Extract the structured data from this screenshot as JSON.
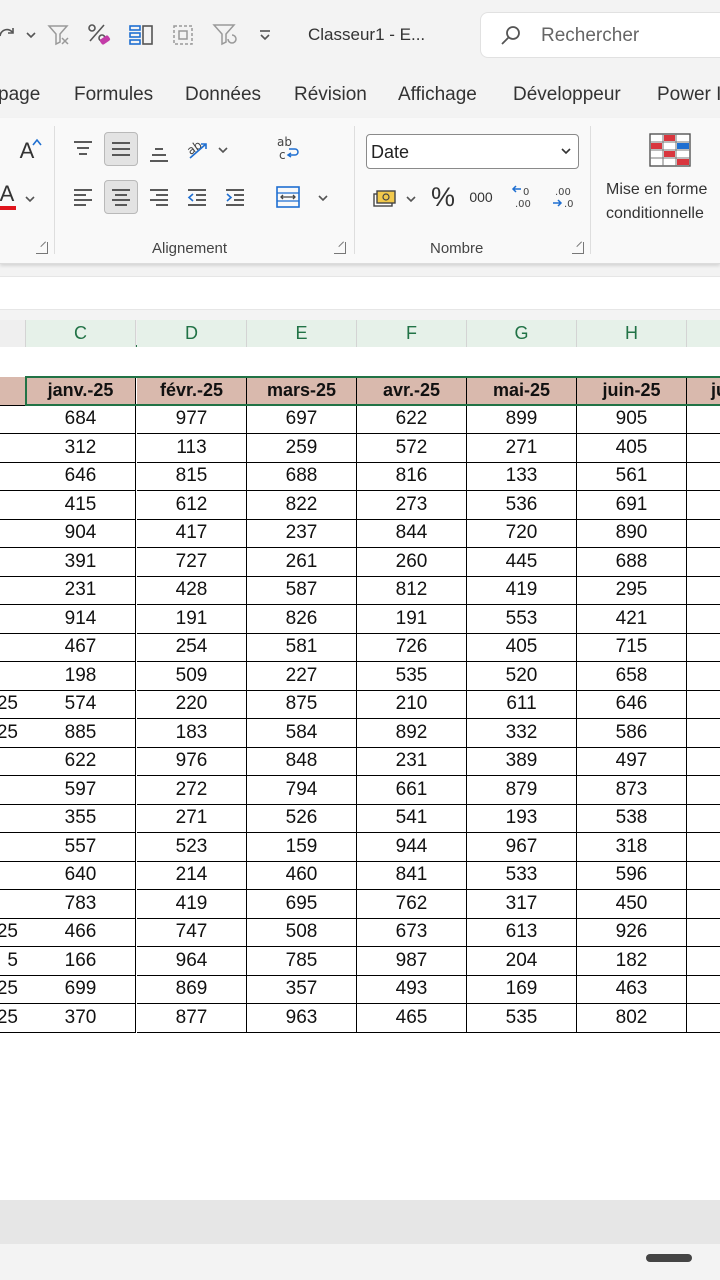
{
  "titlebar": {
    "doc_title": "Classeur1  -  E...",
    "search_placeholder": "Rechercher"
  },
  "ribbon_tabs": [
    "page",
    "Formules",
    "Données",
    "Révision",
    "Affichage",
    "Développeur",
    "Power I"
  ],
  "ribbon": {
    "alignment_label": "Alignement",
    "number_label": "Nombre",
    "number_format_value": "Date",
    "percent_symbol": "%",
    "thousands_symbol": "000",
    "cond_format_line1": "Mise en forme",
    "cond_format_line2": "conditionnelle",
    "font_letter_a": "A",
    "wrap_text_glyph": "ab"
  },
  "sheet": {
    "columns": [
      "C",
      "D",
      "E",
      "F",
      "G",
      "H"
    ],
    "header_row": [
      "janv.-25",
      "févr.-25",
      "mars-25",
      "avr.-25",
      "mai-25",
      "juin-25"
    ],
    "partial_next_header": "ju",
    "row_label_fragments": [
      "",
      "",
      "",
      "",
      "",
      "",
      "",
      "",
      "",
      "",
      "25",
      "25",
      "",
      "",
      "",
      "",
      "",
      "",
      "25",
      "5",
      "25",
      "25"
    ],
    "rows": [
      [
        684,
        977,
        697,
        622,
        899,
        905
      ],
      [
        312,
        113,
        259,
        572,
        271,
        405
      ],
      [
        646,
        815,
        688,
        816,
        133,
        561
      ],
      [
        415,
        612,
        822,
        273,
        536,
        691
      ],
      [
        904,
        417,
        237,
        844,
        720,
        890
      ],
      [
        391,
        727,
        261,
        260,
        445,
        688
      ],
      [
        231,
        428,
        587,
        812,
        419,
        295
      ],
      [
        914,
        191,
        826,
        191,
        553,
        421
      ],
      [
        467,
        254,
        581,
        726,
        405,
        715
      ],
      [
        198,
        509,
        227,
        535,
        520,
        658
      ],
      [
        574,
        220,
        875,
        210,
        611,
        646
      ],
      [
        885,
        183,
        584,
        892,
        332,
        586
      ],
      [
        622,
        976,
        848,
        231,
        389,
        497
      ],
      [
        597,
        272,
        794,
        661,
        879,
        873
      ],
      [
        355,
        271,
        526,
        541,
        193,
        538
      ],
      [
        557,
        523,
        159,
        944,
        967,
        318
      ],
      [
        640,
        214,
        460,
        841,
        533,
        596
      ],
      [
        783,
        419,
        695,
        762,
        317,
        450
      ],
      [
        466,
        747,
        508,
        673,
        613,
        926
      ],
      [
        166,
        964,
        785,
        987,
        204,
        182
      ],
      [
        699,
        869,
        357,
        493,
        169,
        463
      ],
      [
        370,
        877,
        963,
        465,
        535,
        802
      ]
    ]
  },
  "colors": {
    "accent_green": "#217346",
    "header_fill": "#d9b9ad"
  }
}
